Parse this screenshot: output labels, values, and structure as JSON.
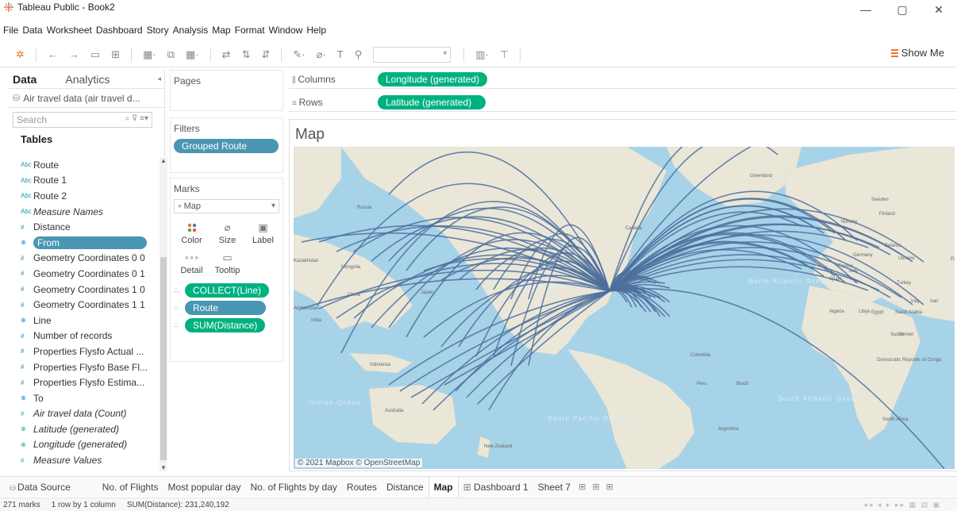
{
  "window": {
    "title": "Tableau Public - Book2",
    "controls": [
      "—",
      "▢",
      "✕"
    ]
  },
  "menu": [
    "File",
    "Data",
    "Worksheet",
    "Dashboard",
    "Story",
    "Analysis",
    "Map",
    "Format",
    "Window",
    "Help"
  ],
  "toolbar": {
    "show_me": "Show Me",
    "accent": "#e8762b"
  },
  "data_pane": {
    "tab_data": "Data",
    "tab_analytics": "Analytics",
    "datasource": "Air travel data (air travel d...",
    "search_placeholder": "Search",
    "tables_label": "Tables",
    "fields": [
      {
        "name": "Route",
        "icon": "Abc",
        "kind": "dim",
        "italic": false
      },
      {
        "name": "Route 1",
        "icon": "Abc",
        "kind": "dim",
        "italic": false
      },
      {
        "name": "Route 2",
        "icon": "Abc",
        "kind": "dim",
        "italic": false
      },
      {
        "name": "Measure Names",
        "icon": "Abc",
        "kind": "dim",
        "italic": true
      },
      {
        "name": "Distance",
        "icon": "#",
        "kind": "dim",
        "italic": false
      },
      {
        "name": "From",
        "icon": "⊕",
        "kind": "dim",
        "italic": false,
        "selected": true
      },
      {
        "name": "Geometry Coordinates 0 0",
        "icon": "#",
        "kind": "dim",
        "italic": false
      },
      {
        "name": "Geometry Coordinates 0 1",
        "icon": "#",
        "kind": "dim",
        "italic": false
      },
      {
        "name": "Geometry Coordinates 1 0",
        "icon": "#",
        "kind": "dim",
        "italic": false
      },
      {
        "name": "Geometry Coordinates 1 1",
        "icon": "#",
        "kind": "dim",
        "italic": false
      },
      {
        "name": "Line",
        "icon": "⊕",
        "kind": "dim",
        "italic": false
      },
      {
        "name": "Number of records",
        "icon": "#",
        "kind": "dim",
        "italic": false
      },
      {
        "name": "Properties Flysfo Actual ...",
        "icon": "#",
        "kind": "dim",
        "italic": false
      },
      {
        "name": "Properties Flysfo Base Fl...",
        "icon": "#",
        "kind": "dim",
        "italic": false
      },
      {
        "name": "Properties Flysfo Estima...",
        "icon": "#",
        "kind": "dim",
        "italic": false
      },
      {
        "name": "To",
        "icon": "⊕",
        "kind": "dim",
        "italic": false
      },
      {
        "name": "Air travel data (Count)",
        "icon": "#",
        "kind": "mea",
        "italic": true
      },
      {
        "name": "Latitude (generated)",
        "icon": "⊕",
        "kind": "mea",
        "italic": true
      },
      {
        "name": "Longitude (generated)",
        "icon": "⊕",
        "kind": "mea",
        "italic": true
      },
      {
        "name": "Measure Values",
        "icon": "#",
        "kind": "mea",
        "italic": true
      }
    ]
  },
  "pages": {
    "title": "Pages"
  },
  "filters": {
    "title": "Filters",
    "pills": [
      "Grouped Route"
    ]
  },
  "marks": {
    "title": "Marks",
    "type": "Map",
    "buttons": [
      {
        "label": "Color",
        "icon": "color-icon"
      },
      {
        "label": "Size",
        "icon": "size-icon"
      },
      {
        "label": "Label",
        "icon": "label-icon"
      },
      {
        "label": "Detail",
        "icon": "detail-icon"
      },
      {
        "label": "Tooltip",
        "icon": "tooltip-icon"
      }
    ],
    "pills": [
      {
        "label": "COLLECT(Line)",
        "color": "green"
      },
      {
        "label": "Route",
        "color": "blue"
      },
      {
        "label": "SUM(Distance)",
        "color": "green"
      }
    ]
  },
  "shelves": {
    "columns_label": "Columns",
    "columns_pill": "Longitude (generated)",
    "rows_label": "Rows",
    "rows_pill": "Latitude (generated)"
  },
  "view": {
    "title": "Map",
    "attribution": "© 2021 Mapbox © OpenStreetMap",
    "route_color": "#4e6e9c",
    "ocean_color": "#a7d3e9",
    "land_color": "#eae7d9",
    "place_labels": [
      "Russia",
      "Greenland",
      "Sweden",
      "Finland",
      "Norway",
      "Canada",
      "Belarus",
      "Germany",
      "Ukraine",
      "France",
      "Italy",
      "Spain",
      "Turkey",
      "Iraq",
      "Iran",
      "Pakistan",
      "Kazakhstan",
      "Mongolia",
      "China",
      "Japan",
      "India",
      "Afghanistan",
      "Algeria",
      "Libya",
      "Egypt",
      "Saudi Arabia",
      "Sudan",
      "Yemen",
      "Democratic Republic of Congo",
      "South Africa",
      "Colombia",
      "Peru",
      "Brazil",
      "Argentina",
      "Indonesia",
      "Australia",
      "New Zealand",
      "North Pacific Ocean",
      "North Atlantic Ocean",
      "South Pacific Ocean",
      "South Atlantic Ocean",
      "Indian Ocean"
    ]
  },
  "sheet_tabs": {
    "data_source": "Data Source",
    "tabs": [
      "No. of Flights",
      "Most popular day",
      "No. of Flights by day",
      "Routes",
      "Distance",
      "Map",
      "Dashboard 1",
      "Sheet 7"
    ],
    "active": "Map"
  },
  "status": {
    "marks": "271 marks",
    "dims": "1 row by 1 column",
    "sum": "SUM(Distance): 231,240,192"
  }
}
